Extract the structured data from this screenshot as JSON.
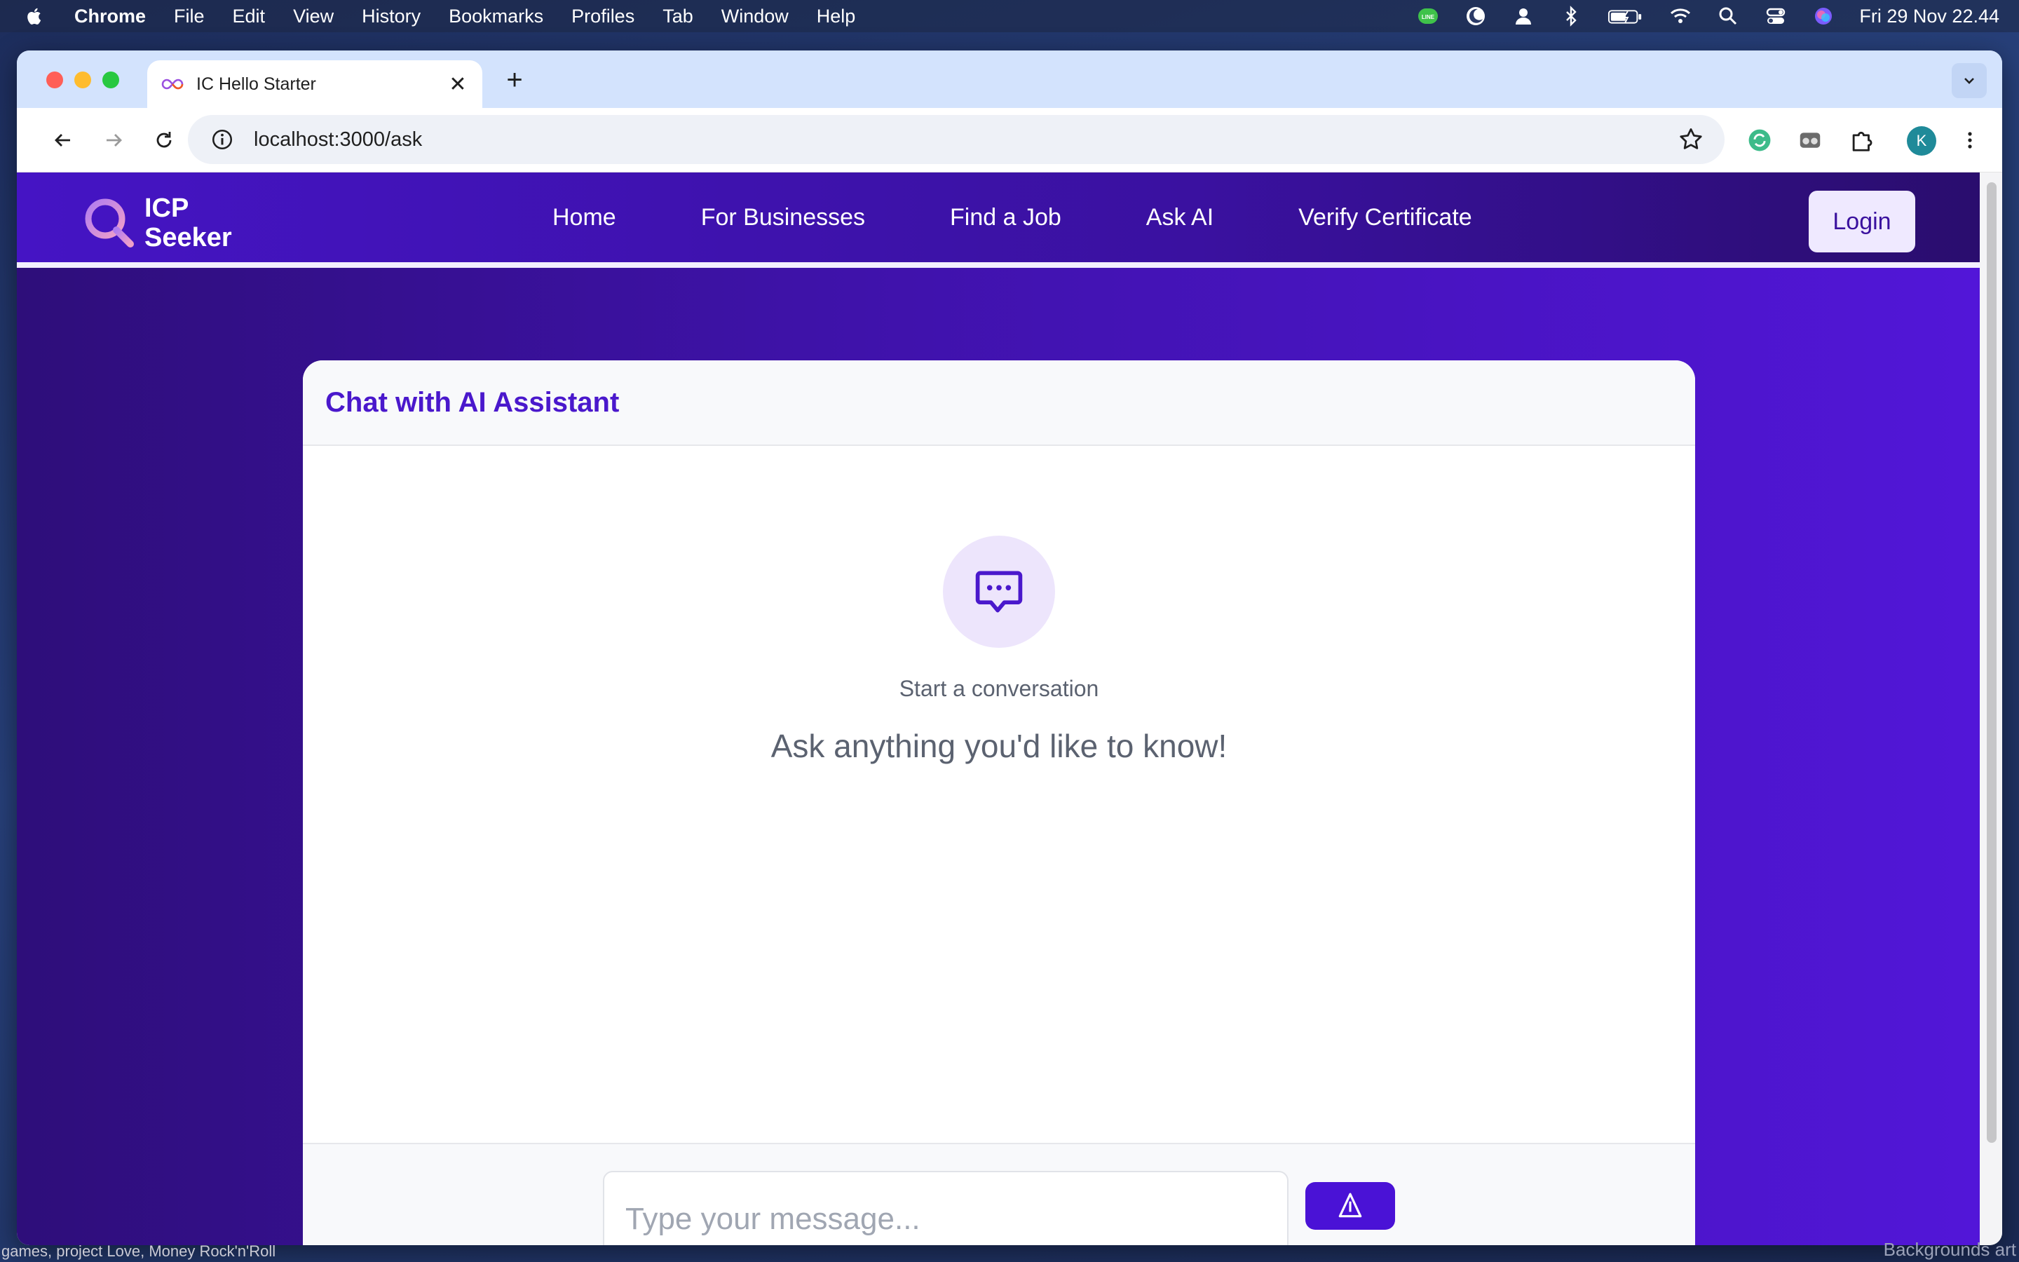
{
  "menubar": {
    "app_name": "Chrome",
    "items": [
      "File",
      "Edit",
      "View",
      "History",
      "Bookmarks",
      "Profiles",
      "Tab",
      "Window",
      "Help"
    ],
    "clock": "Fri 29 Nov  22.44",
    "status_icons": [
      "line-icon",
      "moon-icon",
      "user-icon",
      "bluetooth-icon",
      "battery-icon",
      "wifi-icon",
      "spotlight-icon",
      "control-center-icon",
      "siri-icon"
    ]
  },
  "browser": {
    "tab_title": "IC Hello Starter",
    "url": "localhost:3000/ask",
    "profile_initial": "K"
  },
  "site": {
    "logo_line1": "ICP",
    "logo_line2": "Seeker",
    "nav": [
      "Home",
      "For Businesses",
      "Find a Job",
      "Ask AI",
      "Verify Certificate"
    ],
    "login_label": "Login"
  },
  "chat": {
    "title": "Chat with AI Assistant",
    "empty_title": "Start a conversation",
    "empty_subtitle": "Ask anything you'd like to know!",
    "input_placeholder": "Type your message..."
  },
  "desktop": {
    "caption_left": "games, project Love, Money Rock'n'Roll",
    "caption_right": "Backgrounds art"
  },
  "colors": {
    "brand_primary": "#4a12d6",
    "header_bg": "#3a11a0",
    "title_color": "#4a18cc"
  }
}
